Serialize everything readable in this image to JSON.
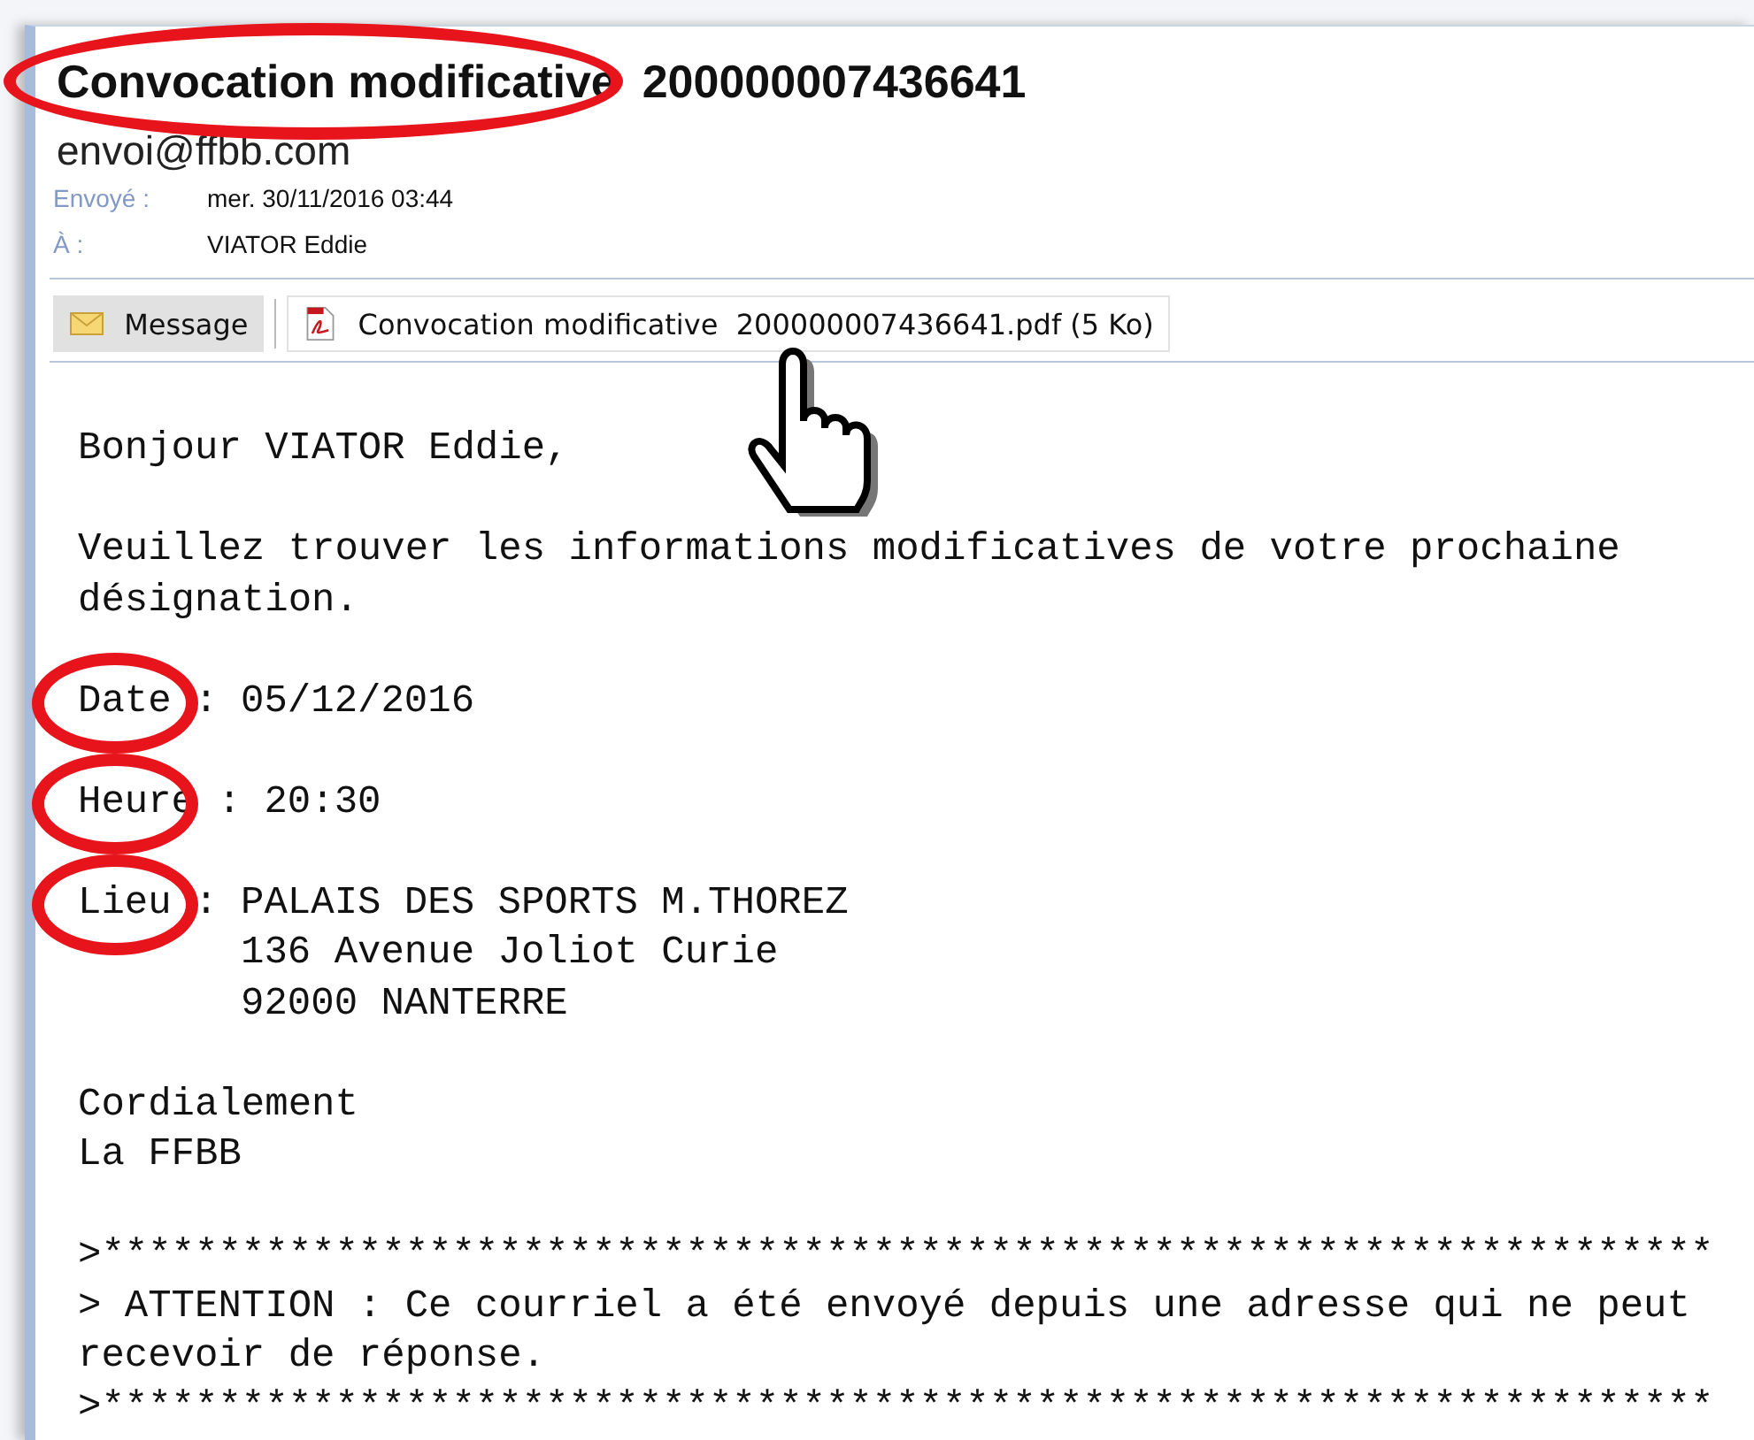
{
  "message": {
    "subject": {
      "text": "Convocation modificative  200000007436641",
      "circled": true
    },
    "sender": "envoi@ffbb.com",
    "meta": [
      {
        "label": "Envoyé :",
        "value": "mer. 30/11/2016 03:44"
      },
      {
        "label": "À :",
        "value": "VIATOR Eddie"
      }
    ],
    "tabs": [
      {
        "kind": "message",
        "label": "Message",
        "selected": true
      },
      {
        "kind": "pdf",
        "label": "Convocation modificative  200000007436641.pdf (5 Ko)",
        "selected": false
      }
    ],
    "body": [
      {
        "kind": "text",
        "lines": [
          "Bonjour VIATOR Eddie,"
        ]
      },
      {
        "kind": "text",
        "lines": [
          "Veuillez trouver les informations modificatives de votre prochaine",
          "désignation."
        ]
      },
      {
        "kind": "field",
        "label": "Date",
        "separator": ":",
        "value": [
          "05/12/2016"
        ],
        "circled": true
      },
      {
        "kind": "field",
        "label": "Heure",
        "separator": ":",
        "value": [
          "20:30"
        ],
        "circled": true
      },
      {
        "kind": "field",
        "label": "Lieu",
        "separator": ":",
        "value": [
          "PALAIS DES SPORTS M.THOREZ",
          "136 Avenue Joliot Curie",
          "92000 NANTERRE"
        ],
        "circled": true
      },
      {
        "kind": "text",
        "lines": [
          "Cordialement",
          "La FFBB"
        ]
      },
      {
        "kind": "notice",
        "rule_top": ">*********************************************************************",
        "lines": [
          "> ATTENTION : Ce courriel a été envoyé depuis une adresse qui ne peut",
          "recevoir de réponse."
        ],
        "rule_bottom": ">*********************************************************************"
      }
    ]
  }
}
